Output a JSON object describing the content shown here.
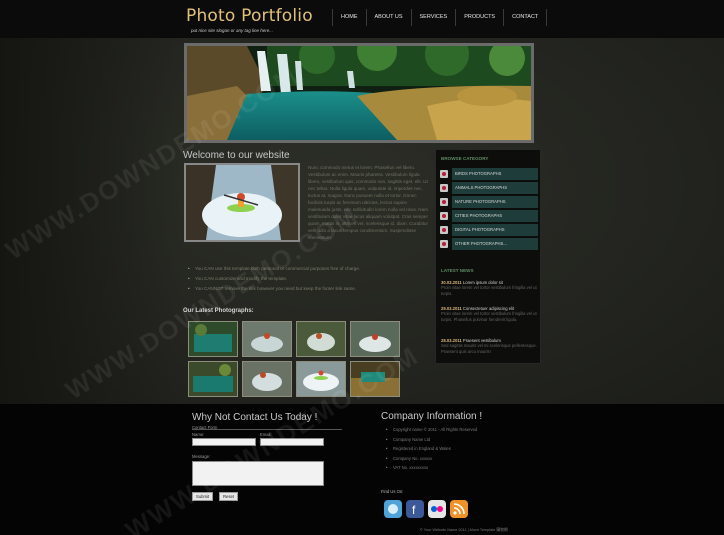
{
  "header": {
    "logo": "Photo Portfolio",
    "tagline": "put nice site slogan or any tag line here...",
    "nav": [
      "HOME",
      "ABOUT US",
      "SERVICES",
      "PRODUCTS",
      "CONTACT"
    ]
  },
  "welcome": {
    "title": "Welcome to our website",
    "text_right": "Nunc commodo metus et lorem. Phasellus vel libero. Vestibulum ac enim. Mauris pharetra. Vestibulum ligula libero, vestibulum quis, commodo non, sagittis eget, elit. Ut nec tellus. Nulla ligula quam, vulputate id, imperdiet nec, luctus at, magna. Nunc posuere nulla et tortor. Donec facilisis turpis ac ferentum ultricies, lectus sapien malesuada justo, nec sollicitudin lorem nulla vel risus. Nam vestibulum dolor vitae lacus aliquam volutpat. Cras semper quam, mattis in, ultrices vel, scelerisque id, diam. Curabitur velit odio a lacus tempus condimentum. Suspendisse elementum.",
    "bullets": [
      "You CAN use this template both personal or commercial purposes free of charge.",
      "You CAN customize and modify the template.",
      "You CANNOT remove the link however you need but keep the footer link same."
    ],
    "latest_title": "Our Latest Photographs:"
  },
  "sidebar": {
    "category_title": "BROWSE CATEGORY",
    "categories": [
      "BIRDS PHOTOGRAPHS",
      "ANIMALS PHOTOGRAPHS",
      "NATURE PHOTOGRAPHS",
      "CITIES PHOTOGRAPHS",
      "DIGITAL PHOTOGRAPHS",
      "OTHER PHOTOGRAPHS..."
    ],
    "news_title": "LATEST NEWS",
    "news": [
      {
        "date": "30.03.2011",
        "headline": "Lorem ipsum dolor sit",
        "text": "Proin vitae lorem vel tortor vestibulum fringilla vel ut turpis."
      },
      {
        "date": "29.03.2011",
        "headline": "Consectetuer adipiscing elit",
        "text": "Proin vitae lorem vel tortor vestibulum fringilla vel ut turpis. Phasellus pulvinar hendrerit ligula."
      },
      {
        "date": "28.03.2011",
        "headline": "Praesent vestibulum",
        "text": "Sed sagittis mauris vel mi scelerisque pellentesque. Praesent quis arcu mauris!"
      }
    ]
  },
  "footer": {
    "contact_title": "Why Not Contact Us Today !",
    "form_legend": "Contact Form",
    "name_label": "Name:",
    "email_label": "Email:",
    "message_label": "Message:",
    "submit_label": "Submit",
    "reset_label": "Reset",
    "company_title": "Company Information !",
    "company_items": [
      "Copyright name © 2011 - All Rights Reserved",
      "Company Name Ltd",
      "Registered in England & Wales",
      "Company No. xxxxxx",
      "VAT No. xxxxxxxxx"
    ],
    "find_us": "Find Us On:",
    "copyright": "© Your Website Name 2011 | Move Template 購物網"
  },
  "watermark": "WWW.DOWNDEMO.COM",
  "colors": {
    "accent_gold": "#e2c177",
    "category_bg": "#1e3d3a",
    "news_date": "#d9b57a",
    "news_head": "#5e8d60"
  }
}
